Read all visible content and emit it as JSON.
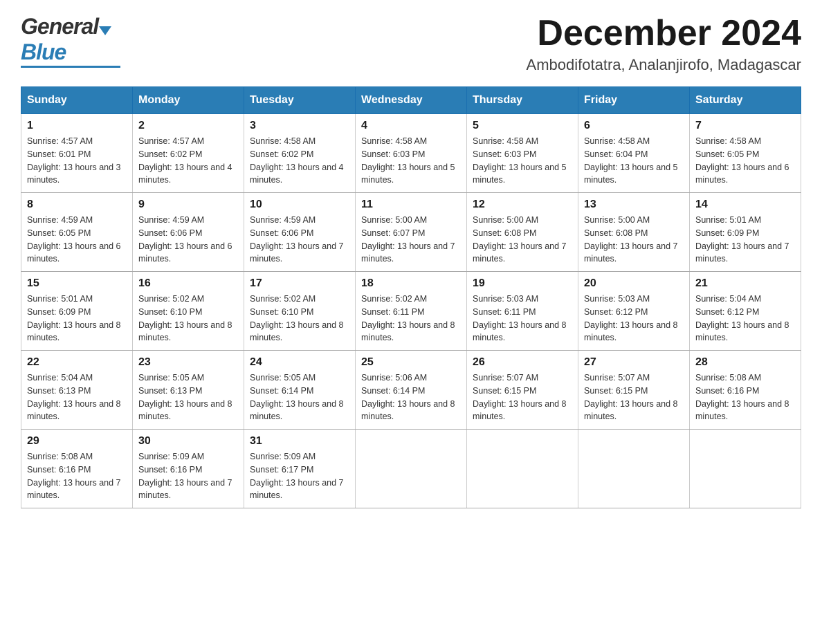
{
  "header": {
    "logo": {
      "general": "General",
      "blue": "Blue",
      "tagline": "GeneralBlue"
    },
    "title": "December 2024",
    "location": "Ambodifotatra, Analanjirofo, Madagascar"
  },
  "calendar": {
    "days": [
      "Sunday",
      "Monday",
      "Tuesday",
      "Wednesday",
      "Thursday",
      "Friday",
      "Saturday"
    ],
    "weeks": [
      [
        {
          "day": "1",
          "sunrise": "4:57 AM",
          "sunset": "6:01 PM",
          "daylight": "13 hours and 3 minutes."
        },
        {
          "day": "2",
          "sunrise": "4:57 AM",
          "sunset": "6:02 PM",
          "daylight": "13 hours and 4 minutes."
        },
        {
          "day": "3",
          "sunrise": "4:58 AM",
          "sunset": "6:02 PM",
          "daylight": "13 hours and 4 minutes."
        },
        {
          "day": "4",
          "sunrise": "4:58 AM",
          "sunset": "6:03 PM",
          "daylight": "13 hours and 5 minutes."
        },
        {
          "day": "5",
          "sunrise": "4:58 AM",
          "sunset": "6:03 PM",
          "daylight": "13 hours and 5 minutes."
        },
        {
          "day": "6",
          "sunrise": "4:58 AM",
          "sunset": "6:04 PM",
          "daylight": "13 hours and 5 minutes."
        },
        {
          "day": "7",
          "sunrise": "4:58 AM",
          "sunset": "6:05 PM",
          "daylight": "13 hours and 6 minutes."
        }
      ],
      [
        {
          "day": "8",
          "sunrise": "4:59 AM",
          "sunset": "6:05 PM",
          "daylight": "13 hours and 6 minutes."
        },
        {
          "day": "9",
          "sunrise": "4:59 AM",
          "sunset": "6:06 PM",
          "daylight": "13 hours and 6 minutes."
        },
        {
          "day": "10",
          "sunrise": "4:59 AM",
          "sunset": "6:06 PM",
          "daylight": "13 hours and 7 minutes."
        },
        {
          "day": "11",
          "sunrise": "5:00 AM",
          "sunset": "6:07 PM",
          "daylight": "13 hours and 7 minutes."
        },
        {
          "day": "12",
          "sunrise": "5:00 AM",
          "sunset": "6:08 PM",
          "daylight": "13 hours and 7 minutes."
        },
        {
          "day": "13",
          "sunrise": "5:00 AM",
          "sunset": "6:08 PM",
          "daylight": "13 hours and 7 minutes."
        },
        {
          "day": "14",
          "sunrise": "5:01 AM",
          "sunset": "6:09 PM",
          "daylight": "13 hours and 7 minutes."
        }
      ],
      [
        {
          "day": "15",
          "sunrise": "5:01 AM",
          "sunset": "6:09 PM",
          "daylight": "13 hours and 8 minutes."
        },
        {
          "day": "16",
          "sunrise": "5:02 AM",
          "sunset": "6:10 PM",
          "daylight": "13 hours and 8 minutes."
        },
        {
          "day": "17",
          "sunrise": "5:02 AM",
          "sunset": "6:10 PM",
          "daylight": "13 hours and 8 minutes."
        },
        {
          "day": "18",
          "sunrise": "5:02 AM",
          "sunset": "6:11 PM",
          "daylight": "13 hours and 8 minutes."
        },
        {
          "day": "19",
          "sunrise": "5:03 AM",
          "sunset": "6:11 PM",
          "daylight": "13 hours and 8 minutes."
        },
        {
          "day": "20",
          "sunrise": "5:03 AM",
          "sunset": "6:12 PM",
          "daylight": "13 hours and 8 minutes."
        },
        {
          "day": "21",
          "sunrise": "5:04 AM",
          "sunset": "6:12 PM",
          "daylight": "13 hours and 8 minutes."
        }
      ],
      [
        {
          "day": "22",
          "sunrise": "5:04 AM",
          "sunset": "6:13 PM",
          "daylight": "13 hours and 8 minutes."
        },
        {
          "day": "23",
          "sunrise": "5:05 AM",
          "sunset": "6:13 PM",
          "daylight": "13 hours and 8 minutes."
        },
        {
          "day": "24",
          "sunrise": "5:05 AM",
          "sunset": "6:14 PM",
          "daylight": "13 hours and 8 minutes."
        },
        {
          "day": "25",
          "sunrise": "5:06 AM",
          "sunset": "6:14 PM",
          "daylight": "13 hours and 8 minutes."
        },
        {
          "day": "26",
          "sunrise": "5:07 AM",
          "sunset": "6:15 PM",
          "daylight": "13 hours and 8 minutes."
        },
        {
          "day": "27",
          "sunrise": "5:07 AM",
          "sunset": "6:15 PM",
          "daylight": "13 hours and 8 minutes."
        },
        {
          "day": "28",
          "sunrise": "5:08 AM",
          "sunset": "6:16 PM",
          "daylight": "13 hours and 8 minutes."
        }
      ],
      [
        {
          "day": "29",
          "sunrise": "5:08 AM",
          "sunset": "6:16 PM",
          "daylight": "13 hours and 7 minutes."
        },
        {
          "day": "30",
          "sunrise": "5:09 AM",
          "sunset": "6:16 PM",
          "daylight": "13 hours and 7 minutes."
        },
        {
          "day": "31",
          "sunrise": "5:09 AM",
          "sunset": "6:17 PM",
          "daylight": "13 hours and 7 minutes."
        },
        null,
        null,
        null,
        null
      ]
    ]
  }
}
